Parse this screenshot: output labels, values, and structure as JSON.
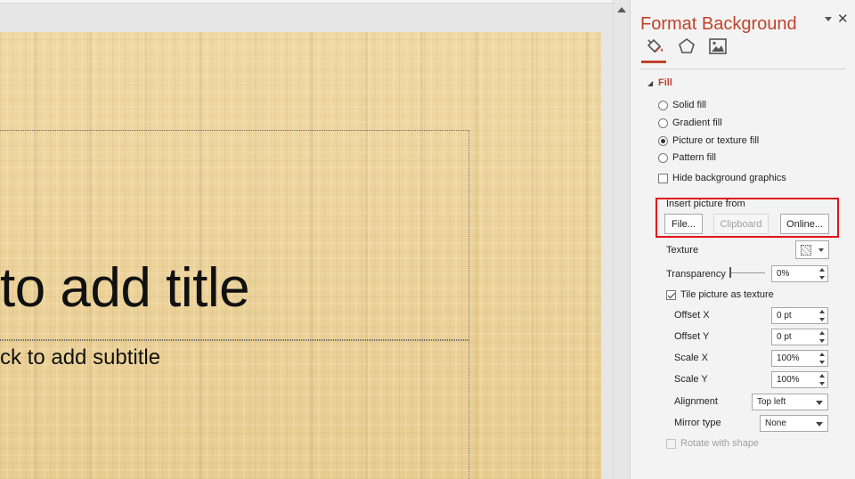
{
  "slide": {
    "title_placeholder": "to add title",
    "subtitle_placeholder": "ck to add subtitle"
  },
  "pane": {
    "title": "Format Background",
    "tabs": [
      {
        "icon": "fill-bucket-icon"
      },
      {
        "icon": "pentagon-effects-icon"
      },
      {
        "icon": "picture-icon"
      }
    ],
    "section": "Fill",
    "fill_options": [
      {
        "label": "Solid fill",
        "checked": false
      },
      {
        "label": "Gradient fill",
        "checked": false
      },
      {
        "label": "Picture or texture fill",
        "checked": true
      },
      {
        "label": "Pattern fill",
        "checked": false
      }
    ],
    "hide_graphics_label": "Hide background graphics",
    "insert_label": "Insert picture from",
    "buttons": {
      "file": "File...",
      "clipboard": "Clipboard",
      "online": "Online..."
    },
    "texture_label": "Texture",
    "transparency_label": "Transparency",
    "transparency_value": "0%",
    "tile_label": "Tile picture as texture",
    "offset_x_label": "Offset X",
    "offset_x_value": "0 pt",
    "offset_y_label": "Offset Y",
    "offset_y_value": "0 pt",
    "scale_x_label": "Scale X",
    "scale_x_value": "100%",
    "scale_y_label": "Scale Y",
    "scale_y_value": "100%",
    "alignment_label": "Alignment",
    "alignment_value": "Top left",
    "mirror_label": "Mirror type",
    "mirror_value": "None",
    "rotate_label": "Rotate with shape"
  },
  "colors": {
    "accent": "#c0432b",
    "highlight_box": "#e2141b",
    "slide_bg": "#ecd39b"
  }
}
